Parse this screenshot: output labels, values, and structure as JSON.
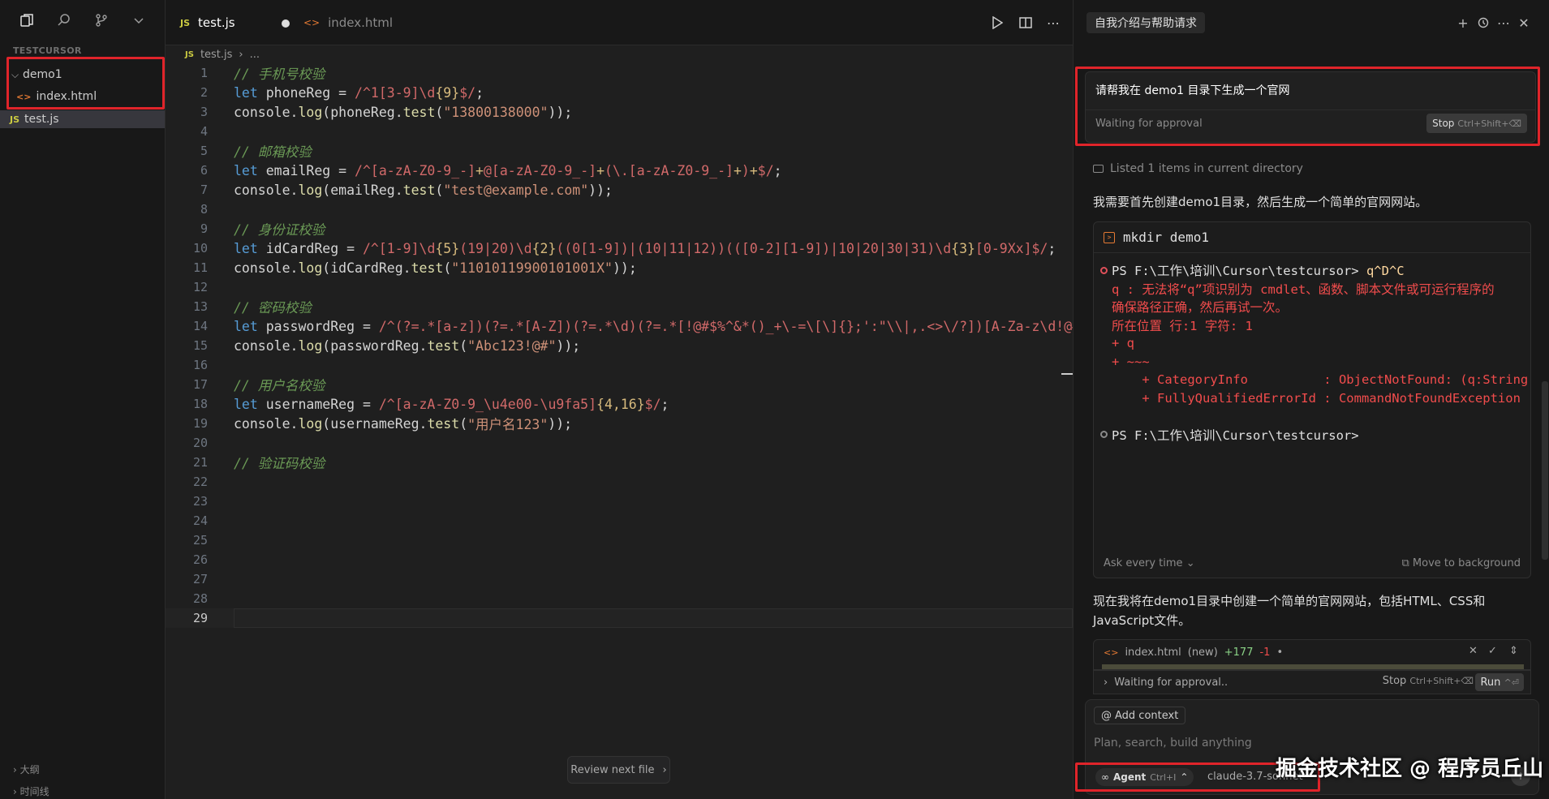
{
  "explorer": {
    "project": "TESTCURSOR",
    "folder": "demo1",
    "files": [
      "index.html",
      "test.js"
    ],
    "outline_label": "大纲",
    "timeline_label": "时间线"
  },
  "editor": {
    "tabs": [
      {
        "label": "test.js",
        "badge": "JS"
      },
      {
        "label": "index.html",
        "badge": "<>"
      }
    ],
    "breadcrumb": {
      "badge": "JS",
      "file": "test.js",
      "rest": "..."
    },
    "lines": [
      {
        "n": "1",
        "parts": [
          [
            "c-com",
            "// 手机号校验"
          ]
        ]
      },
      {
        "n": "2",
        "parts": [
          [
            "c-kw",
            "let "
          ],
          [
            "c-txt",
            "phoneReg = "
          ],
          [
            "c-re",
            "/^1[3-9]\\d"
          ],
          [
            "c-q",
            "{9}"
          ],
          [
            "c-re",
            "$/"
          ],
          [
            "c-txt",
            ";"
          ]
        ]
      },
      {
        "n": "3",
        "parts": [
          [
            "c-txt",
            "console."
          ],
          [
            "c-fn",
            "log"
          ],
          [
            "c-txt",
            "(phoneReg."
          ],
          [
            "c-fn",
            "test"
          ],
          [
            "c-txt",
            "("
          ],
          [
            "c-str",
            "\"13800138000\""
          ],
          [
            "c-txt",
            "));"
          ]
        ]
      },
      {
        "n": "4",
        "parts": []
      },
      {
        "n": "5",
        "parts": [
          [
            "c-com",
            "// 邮箱校验"
          ]
        ]
      },
      {
        "n": "6",
        "parts": [
          [
            "c-kw",
            "let "
          ],
          [
            "c-txt",
            "emailReg = "
          ],
          [
            "c-re",
            "/^[a-zA-Z0-9_-]"
          ],
          [
            "c-q",
            "+"
          ],
          [
            "c-re",
            "@[a-zA-Z0-9_-]"
          ],
          [
            "c-q",
            "+"
          ],
          [
            "c-re",
            "(\\.[a-zA-Z0-9_-]"
          ],
          [
            "c-q",
            "+"
          ],
          [
            "c-re",
            ")"
          ],
          [
            "c-q",
            "+"
          ],
          [
            "c-re",
            "$/"
          ],
          [
            "c-txt",
            ";"
          ]
        ]
      },
      {
        "n": "7",
        "parts": [
          [
            "c-txt",
            "console."
          ],
          [
            "c-fn",
            "log"
          ],
          [
            "c-txt",
            "(emailReg."
          ],
          [
            "c-fn",
            "test"
          ],
          [
            "c-txt",
            "("
          ],
          [
            "c-str",
            "\"test@example.com\""
          ],
          [
            "c-txt",
            "));"
          ]
        ]
      },
      {
        "n": "8",
        "parts": []
      },
      {
        "n": "9",
        "parts": [
          [
            "c-com",
            "// 身份证校验"
          ]
        ]
      },
      {
        "n": "10",
        "parts": [
          [
            "c-kw",
            "let "
          ],
          [
            "c-txt",
            "idCardReg = "
          ],
          [
            "c-re",
            "/^[1-9]\\d"
          ],
          [
            "c-q",
            "{5}"
          ],
          [
            "c-re",
            "(19|20)\\d"
          ],
          [
            "c-q",
            "{2}"
          ],
          [
            "c-re",
            "((0[1-9])|(10|11|12))(([0-2][1-9])|10|20|30|31)\\d"
          ],
          [
            "c-q",
            "{3}"
          ],
          [
            "c-re",
            "[0-9Xx]$/"
          ],
          [
            "c-txt",
            ";"
          ]
        ]
      },
      {
        "n": "11",
        "parts": [
          [
            "c-txt",
            "console."
          ],
          [
            "c-fn",
            "log"
          ],
          [
            "c-txt",
            "(idCardReg."
          ],
          [
            "c-fn",
            "test"
          ],
          [
            "c-txt",
            "("
          ],
          [
            "c-str",
            "\"11010119900101001X\""
          ],
          [
            "c-txt",
            "));"
          ]
        ]
      },
      {
        "n": "12",
        "parts": []
      },
      {
        "n": "13",
        "parts": [
          [
            "c-com",
            "// 密码校验"
          ]
        ]
      },
      {
        "n": "14",
        "parts": [
          [
            "c-kw",
            "let "
          ],
          [
            "c-txt",
            "passwordReg = "
          ],
          [
            "c-re",
            "/^(?=.*[a-z])(?=.*[A-Z])(?=.*\\d)(?=.*[!@#$%^&*()_+\\-=\\[\\]{};':\"\\\\|,.<>\\/?])[A-Za-z\\d!@#$%^"
          ]
        ]
      },
      {
        "n": "15",
        "parts": [
          [
            "c-txt",
            "console."
          ],
          [
            "c-fn",
            "log"
          ],
          [
            "c-txt",
            "(passwordReg."
          ],
          [
            "c-fn",
            "test"
          ],
          [
            "c-txt",
            "("
          ],
          [
            "c-str",
            "\"Abc123!@#\""
          ],
          [
            "c-txt",
            "));"
          ]
        ]
      },
      {
        "n": "16",
        "parts": []
      },
      {
        "n": "17",
        "parts": [
          [
            "c-com",
            "// 用户名校验"
          ]
        ]
      },
      {
        "n": "18",
        "parts": [
          [
            "c-kw",
            "let "
          ],
          [
            "c-txt",
            "usernameReg = "
          ],
          [
            "c-re",
            "/^[a-zA-Z0-9_\\u4e00-\\u9fa5]"
          ],
          [
            "c-q",
            "{4,16}"
          ],
          [
            "c-re",
            "$/"
          ],
          [
            "c-txt",
            ";"
          ]
        ]
      },
      {
        "n": "19",
        "parts": [
          [
            "c-txt",
            "console."
          ],
          [
            "c-fn",
            "log"
          ],
          [
            "c-txt",
            "(usernameReg."
          ],
          [
            "c-fn",
            "test"
          ],
          [
            "c-txt",
            "("
          ],
          [
            "c-str",
            "\"用户名123\""
          ],
          [
            "c-txt",
            "));"
          ]
        ]
      },
      {
        "n": "20",
        "parts": []
      },
      {
        "n": "21",
        "parts": [
          [
            "c-com",
            "// 验证码校验"
          ]
        ]
      },
      {
        "n": "22",
        "parts": []
      },
      {
        "n": "23",
        "parts": []
      },
      {
        "n": "24",
        "parts": []
      },
      {
        "n": "25",
        "parts": []
      },
      {
        "n": "26",
        "parts": []
      },
      {
        "n": "27",
        "parts": []
      },
      {
        "n": "28",
        "parts": []
      },
      {
        "n": "29",
        "parts": [],
        "current": true
      }
    ],
    "review_next": "Review next file"
  },
  "chat": {
    "tab_title": "自我介绍与帮助请求",
    "prompt": "请帮我在 demo1 目录下生成一个官网",
    "prompt_status": "Waiting for approval",
    "stop_label": "Stop",
    "stop_kbd": "Ctrl+Shift+⌫",
    "listed": "Listed 1 items in current directory",
    "msg1": "我需要首先创建demo1目录，然后生成一个简单的官网网站。",
    "terminal": {
      "command": "mkdir demo1",
      "lines": [
        {
          "dot": "err",
          "parts": [
            [
              "t-ps",
              "PS F:\\工作\\培训\\Cursor\\testcursor> "
            ],
            [
              "t-ok",
              "q^D^C"
            ]
          ]
        },
        {
          "dot": "",
          "parts": [
            [
              "t-err",
              "q : 无法将“q”项识别为 cmdlet、函数、脚本文件或可运行程序的"
            ]
          ]
        },
        {
          "dot": "",
          "parts": [
            [
              "t-err",
              "确保路径正确，然后再试一次。"
            ]
          ]
        },
        {
          "dot": "",
          "parts": [
            [
              "t-err",
              "所在位置 行:1 字符: 1"
            ]
          ]
        },
        {
          "dot": "",
          "parts": [
            [
              "t-err",
              "+ q"
            ]
          ]
        },
        {
          "dot": "",
          "parts": [
            [
              "t-err",
              "+ ~~~"
            ]
          ]
        },
        {
          "dot": "",
          "parts": [
            [
              "t-err",
              "    + CategoryInfo          : ObjectNotFound: (q:String)"
            ]
          ]
        },
        {
          "dot": "",
          "parts": [
            [
              "t-err",
              "    + FullyQualifiedErrorId : CommandNotFoundException"
            ]
          ]
        },
        {
          "dot": "",
          "parts": []
        },
        {
          "dot": "idle",
          "parts": [
            [
              "t-ps",
              "PS F:\\工作\\培训\\Cursor\\testcursor>"
            ]
          ]
        }
      ],
      "ask_mode": "Ask every time",
      "move_bg": "Move to background"
    },
    "msg2": "现在我将在demo1目录中创建一个简单的官网网站，包括HTML、CSS和JavaScript文件。",
    "diff": {
      "file": "index.html",
      "tag": "(new)",
      "added": "+177",
      "removed": "-1"
    },
    "approval": {
      "status": "Waiting for approval..",
      "stop_label": "Stop",
      "stop_kbd": "Ctrl+Shift+⌫",
      "run_label": "Run",
      "run_kbd": "^⏎"
    },
    "composer": {
      "add_context": "Add context",
      "placeholder": "Plan, search, build anything",
      "mode": "Agent",
      "mode_kbd": "Ctrl+I",
      "model": "claude-3.7-sonnet"
    },
    "watermark": "掘金技术社区 @ 程序员丘山"
  },
  "colors": {
    "highlight_box": "#e0242a",
    "accent_js": "#cbcb41",
    "accent_html": "#e37933"
  }
}
